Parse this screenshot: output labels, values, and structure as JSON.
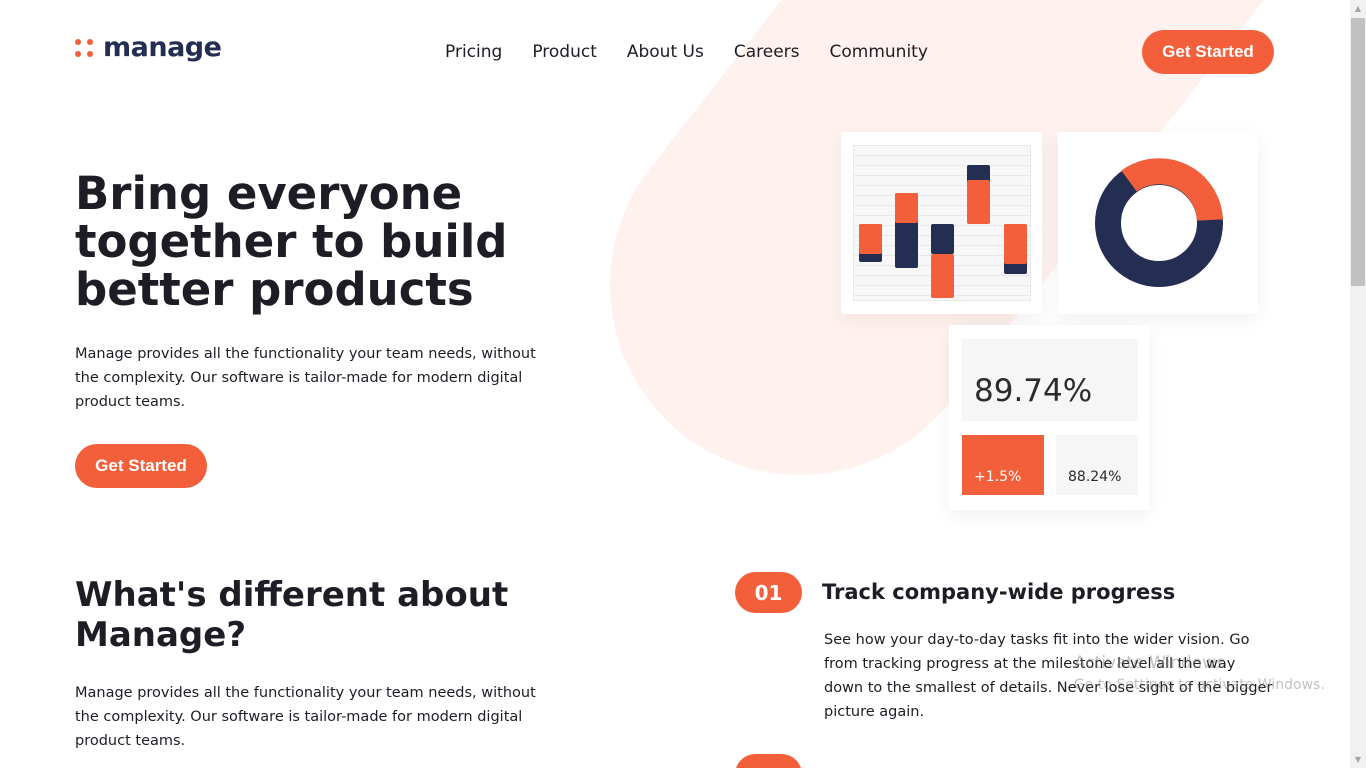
{
  "brand": {
    "name": "manage",
    "accent": "#f25f3a",
    "dark": "#242d52"
  },
  "nav": {
    "items": [
      "Pricing",
      "Product",
      "About Us",
      "Careers",
      "Community"
    ]
  },
  "header": {
    "cta_label": "Get Started"
  },
  "hero": {
    "title": "Bring everyone together to build better products",
    "text": "Manage provides all the functionality your team needs, without the complexity. Our software is tailor-made for modern digital product teams.",
    "cta_label": "Get Started"
  },
  "illustration": {
    "big_stat": "89.74%",
    "change_stat": "+1.5%",
    "secondary_stat": "88.24%"
  },
  "difference": {
    "title": "What's different about Manage?",
    "text": "Manage provides all the functionality your team needs, without the complexity. Our software is tailor-made for modern digital product teams."
  },
  "features": [
    {
      "number": "01",
      "title": "Track company-wide progress",
      "text": "See how your day-to-day tasks fit into the wider vision. Go from tracking progress at the milestone level all the way down to the smallest of details. Never lose sight of the bigger picture again."
    }
  ],
  "watermark": {
    "line1": "Activate Windows",
    "line2": "Go to Settings to activate Windows."
  }
}
